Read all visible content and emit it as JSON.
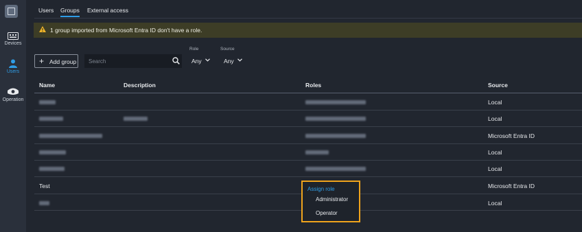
{
  "sidebar": {
    "items": [
      {
        "label": "Devices",
        "icon": "devices-icon"
      },
      {
        "label": "Users",
        "icon": "user-icon",
        "active": true
      },
      {
        "label": "Operation",
        "icon": "operation-icon"
      }
    ]
  },
  "tabs": [
    {
      "label": "Users"
    },
    {
      "label": "Groups",
      "active": true
    },
    {
      "label": "External access"
    }
  ],
  "banner": {
    "text": "1 group imported from Microsoft Entra ID don't have a role.",
    "icon": "warning-icon",
    "color": "#3d3d26"
  },
  "toolbar": {
    "add_label": "Add group",
    "search_placeholder": "Search",
    "role_label": "Role",
    "role_value": "Any",
    "source_label": "Source",
    "source_value": "Any"
  },
  "table": {
    "headers": {
      "name": "Name",
      "description": "Description",
      "roles": "Roles",
      "source": "Source"
    },
    "rows": [
      {
        "name": "",
        "description": "",
        "roles": "",
        "source": "Local"
      },
      {
        "name": "",
        "description": "",
        "roles": "",
        "source": "Local"
      },
      {
        "name": "",
        "description": "",
        "roles": "",
        "source": "Microsoft Entra ID"
      },
      {
        "name": "",
        "description": "",
        "roles": "",
        "source": "Local"
      },
      {
        "name": "",
        "description": "",
        "roles": "",
        "source": "Local"
      },
      {
        "name": "Test",
        "description": "",
        "roles": "",
        "source": "Microsoft Entra ID"
      },
      {
        "name": "",
        "description": "",
        "roles": "",
        "source": "Local"
      }
    ]
  },
  "assign_role_popup": {
    "title": "Assign role",
    "options": [
      "Administrator",
      "Operator"
    ],
    "highlight_color": "#f0a41c"
  },
  "colors": {
    "accent": "#2f9de6",
    "background": "#21262f"
  }
}
